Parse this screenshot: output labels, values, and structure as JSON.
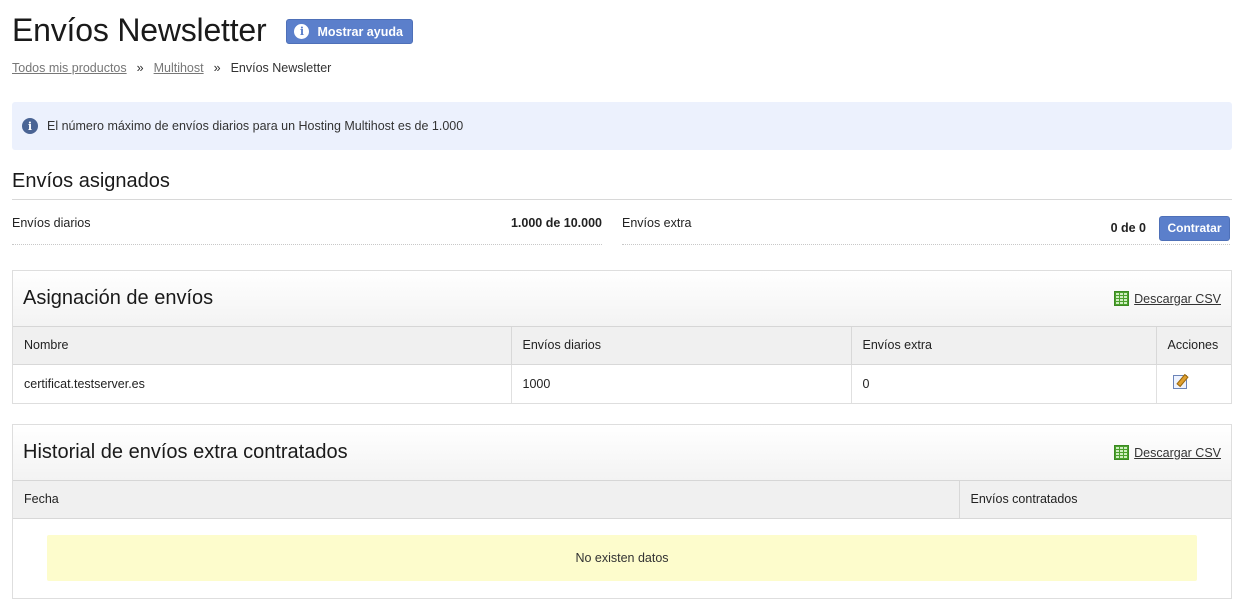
{
  "header": {
    "title": "Envíos Newsletter",
    "help_button": "Mostrar ayuda",
    "help_icon": "i"
  },
  "breadcrumb": {
    "items": [
      "Todos mis productos",
      "Multihost"
    ],
    "separator": "»",
    "current": "Envíos Newsletter"
  },
  "alert": {
    "icon": "i",
    "text": "El número máximo de envíos diarios para un Hosting Multihost es de 1.000"
  },
  "assigned": {
    "title": "Envíos asignados",
    "daily_label": "Envíos diarios",
    "daily_value": "1.000 de 10.000",
    "extra_label": "Envíos extra",
    "extra_value": "0 de 0",
    "contract_button": "Contratar"
  },
  "assignment_panel": {
    "title": "Asignación de envíos",
    "csv_label": "Descargar CSV",
    "columns": [
      "Nombre",
      "Envíos diarios",
      "Envíos extra",
      "Acciones"
    ],
    "rows": [
      {
        "name": "certificat.testserver.es",
        "daily": "1000",
        "extra": "0"
      }
    ]
  },
  "history_panel": {
    "title": "Historial de envíos extra contratados",
    "csv_label": "Descargar CSV",
    "columns": [
      "Fecha",
      "Envíos contratados"
    ],
    "empty_text": "No existen datos"
  },
  "colors": {
    "accent": "#5b7fcb",
    "alert_bg": "#ecf1fd",
    "empty_bg": "#fdfccc"
  }
}
